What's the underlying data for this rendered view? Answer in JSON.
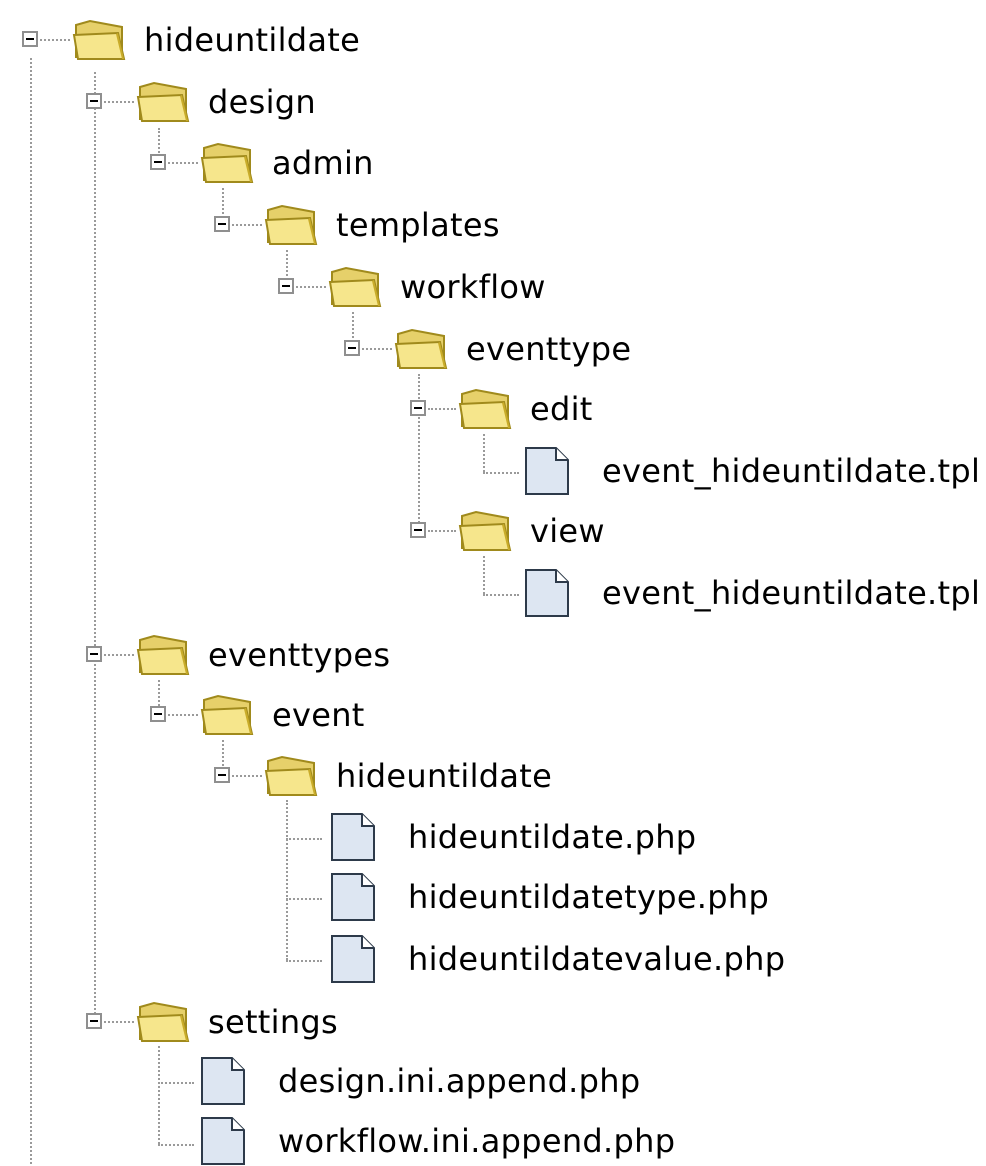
{
  "tree": [
    {
      "id": "n0",
      "label": "hideuntildate",
      "type": "folder",
      "expanded": true,
      "icon": "folder-open-icon"
    },
    {
      "id": "n1",
      "label": "design",
      "type": "folder",
      "expanded": true,
      "icon": "folder-open-icon"
    },
    {
      "id": "n2",
      "label": "admin",
      "type": "folder",
      "expanded": true,
      "icon": "folder-open-icon"
    },
    {
      "id": "n3",
      "label": "templates",
      "type": "folder",
      "expanded": true,
      "icon": "folder-open-icon"
    },
    {
      "id": "n4",
      "label": "workflow",
      "type": "folder",
      "expanded": true,
      "icon": "folder-open-icon"
    },
    {
      "id": "n5",
      "label": "eventtype",
      "type": "folder",
      "expanded": true,
      "icon": "folder-open-icon"
    },
    {
      "id": "n6",
      "label": "edit",
      "type": "folder",
      "expanded": true,
      "icon": "folder-open-icon"
    },
    {
      "id": "n7",
      "label": "event_hideuntildate.tpl",
      "type": "file",
      "icon": "file-icon"
    },
    {
      "id": "n8",
      "label": "view",
      "type": "folder",
      "expanded": true,
      "icon": "folder-open-icon"
    },
    {
      "id": "n9",
      "label": "event_hideuntildate.tpl",
      "type": "file",
      "icon": "file-icon"
    },
    {
      "id": "n10",
      "label": "eventtypes",
      "type": "folder",
      "expanded": true,
      "icon": "folder-open-icon"
    },
    {
      "id": "n11",
      "label": "event",
      "type": "folder",
      "expanded": true,
      "icon": "folder-open-icon"
    },
    {
      "id": "n12",
      "label": "hideuntildate",
      "type": "folder",
      "expanded": true,
      "icon": "folder-open-icon"
    },
    {
      "id": "n13",
      "label": "hideuntildate.php",
      "type": "file",
      "icon": "file-icon"
    },
    {
      "id": "n14",
      "label": "hideuntildatetype.php",
      "type": "file",
      "icon": "file-icon"
    },
    {
      "id": "n15",
      "label": "hideuntildatevalue.php",
      "type": "file",
      "icon": "file-icon"
    },
    {
      "id": "n16",
      "label": "settings",
      "type": "folder",
      "expanded": true,
      "icon": "folder-open-icon"
    },
    {
      "id": "n17",
      "label": "design.ini.append.php",
      "type": "file",
      "icon": "file-icon"
    },
    {
      "id": "n18",
      "label": "workflow.ini.append.php",
      "type": "file",
      "icon": "file-icon"
    }
  ],
  "colors": {
    "folder_fill": "#f6e68c",
    "folder_edge": "#a08a1c",
    "file_fill": "#dde6f2",
    "file_edge": "#2d3a4a",
    "tree_line": "#9a9a9a"
  }
}
